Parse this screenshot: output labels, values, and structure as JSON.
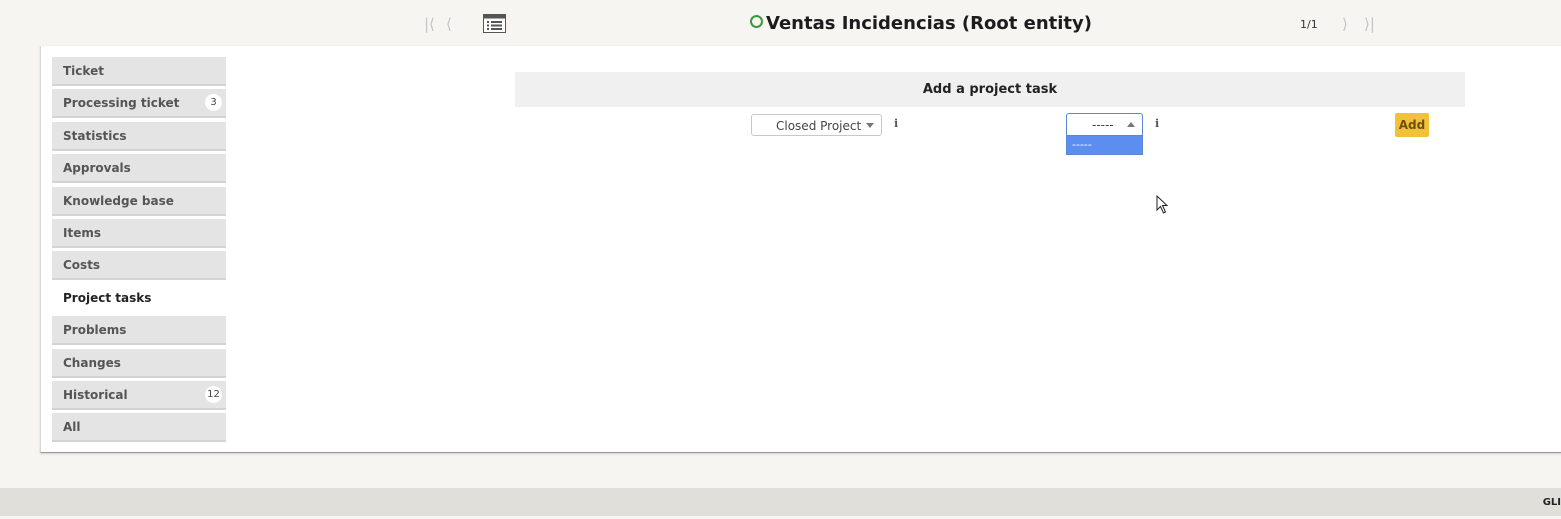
{
  "header": {
    "title": "Ventas Incidencias (Root entity)",
    "counter": "1/1",
    "status_color": "#3a9a3a",
    "icons": [
      "first-page-icon",
      "previous-icon",
      "list-icon",
      "next-icon",
      "last-page-icon"
    ]
  },
  "sidebar": {
    "items": [
      {
        "label": "Ticket",
        "badge": ""
      },
      {
        "label": "Processing ticket",
        "badge": "3"
      },
      {
        "label": "Statistics",
        "badge": ""
      },
      {
        "label": "Approvals",
        "badge": ""
      },
      {
        "label": "Knowledge base",
        "badge": ""
      },
      {
        "label": "Items",
        "badge": ""
      },
      {
        "label": "Costs",
        "badge": ""
      },
      {
        "label": "Project tasks",
        "badge": "",
        "active": true
      },
      {
        "label": "Problems",
        "badge": ""
      },
      {
        "label": "Changes",
        "badge": ""
      },
      {
        "label": "Historical",
        "badge": "12"
      },
      {
        "label": "All",
        "badge": ""
      }
    ]
  },
  "main": {
    "section_title": "Add a project task",
    "project_select": {
      "value": "Closed Project"
    },
    "task_select": {
      "value": "-----",
      "options": [
        "-----"
      ],
      "open": true
    },
    "info_symbol": "i",
    "add_label": "Add",
    "accent_color": "#f2c13c",
    "highlight_color": "#5b8ef0"
  },
  "footer": {
    "text": "GLI"
  }
}
